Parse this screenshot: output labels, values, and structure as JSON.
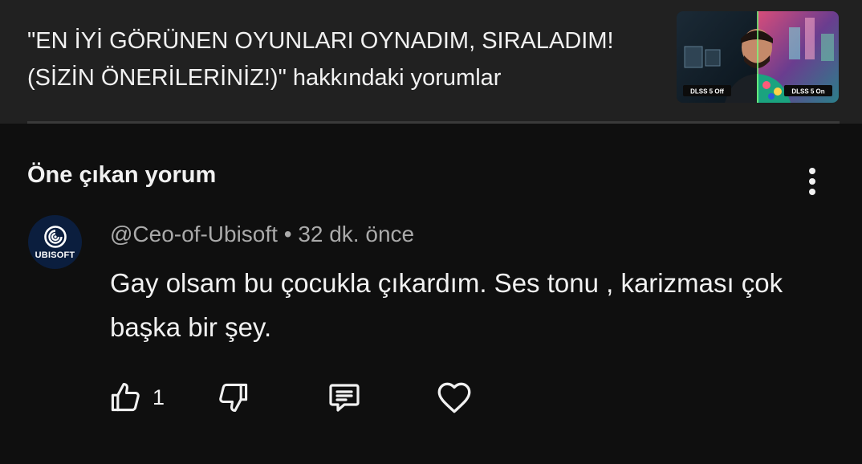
{
  "video": {
    "title": "\"EN İYİ GÖRÜNEN OYUNLARI OYNADIM, SIRALADIM! (SİZİN ÖNERİLERİNİZ!)\" hakkındaki yorumlar",
    "thumbnail": {
      "label_off": "DLSS 5 Off",
      "label_on": "DLSS 5 On"
    }
  },
  "section": {
    "title": "Öne çıkan yorum"
  },
  "comment": {
    "avatar_brand": "UBISOFT",
    "author": "@Ceo-of-Ubisoft",
    "separator": " • ",
    "time": "32 dk. önce",
    "text": "Gay olsam bu çocukla çıkardım. Ses tonu , karizması çok başka bir şey.",
    "likes": "1"
  },
  "icons": {
    "more": "more-vert-icon",
    "like": "thumbs-up-icon",
    "dislike": "thumbs-down-icon",
    "reply": "reply-comment-icon",
    "heart": "heart-icon"
  },
  "colors": {
    "background": "#0f0f0f",
    "header_background": "#212121",
    "text_primary": "#f1f1f1",
    "text_secondary": "#aaaaaa",
    "avatar_background": "#0b1e3e"
  }
}
